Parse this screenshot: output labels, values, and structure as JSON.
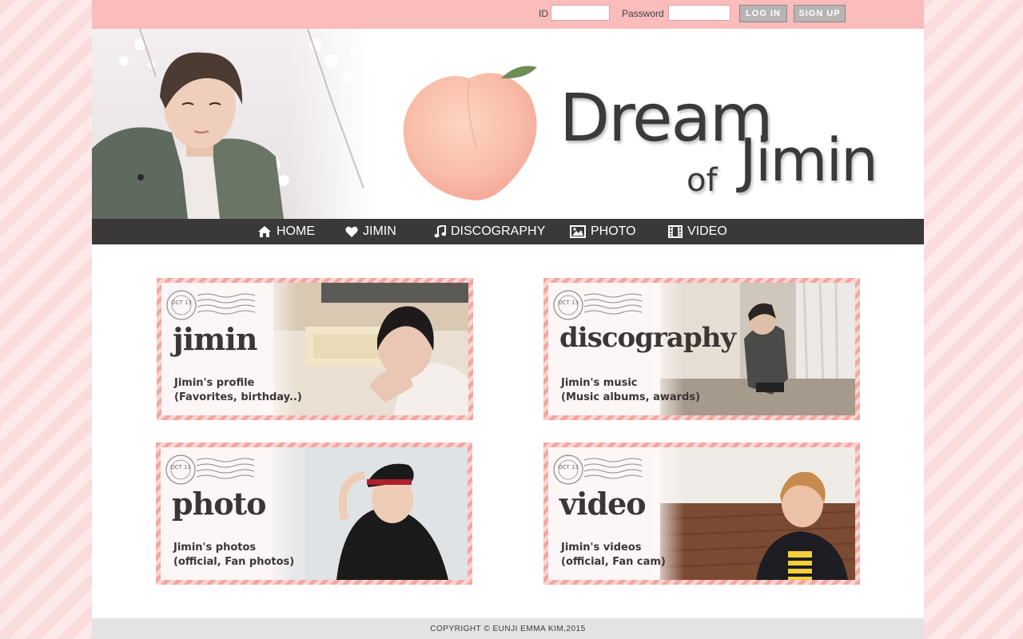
{
  "login": {
    "id_label": "ID",
    "id_value": "",
    "password_label": "Password",
    "password_value": "",
    "login_button": "LOG IN",
    "signup_button": "SIGN UP"
  },
  "header": {
    "logo_line1": "Dream",
    "logo_of": "of",
    "logo_line2": "Jimin"
  },
  "nav": [
    {
      "label": "HOME",
      "icon": "home-icon"
    },
    {
      "label": "JIMIN",
      "icon": "heart-icon"
    },
    {
      "label": "DISCOGRAPHY",
      "icon": "music-note-icon"
    },
    {
      "label": "PHOTO",
      "icon": "image-icon"
    },
    {
      "label": "VIDEO",
      "icon": "film-icon"
    }
  ],
  "cards": [
    {
      "title": "jimin",
      "line1": "Jimin's profile",
      "line2": "(Favorites, birthday..)",
      "stamp": "OCT 13"
    },
    {
      "title": "discography",
      "line1": "Jimin's music",
      "line2": "(Music albums, awards)",
      "stamp": "OCT 13"
    },
    {
      "title": "photo",
      "line1": "Jimin's photos",
      "line2": "(official, Fan photos)",
      "stamp": "OCT 13"
    },
    {
      "title": "video",
      "line1": "Jimin's videos",
      "line2": "(official, Fan cam)",
      "stamp": "OCT 13"
    }
  ],
  "footer": {
    "copyright": "COPYRIGHT © EUNJI EMMA KIM,2015"
  },
  "colors": {
    "topbar": "#fbbcbc",
    "nav": "#3a3838",
    "card_border": "#f3a6a0",
    "footer": "#e3e3e3"
  }
}
